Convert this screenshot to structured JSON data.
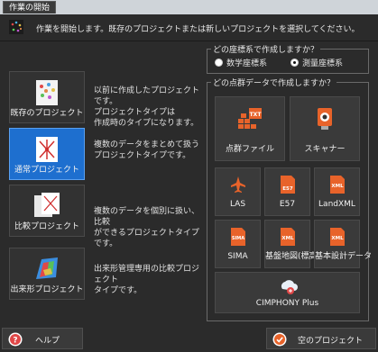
{
  "window": {
    "title": "作業の開始"
  },
  "hint": {
    "text": "作業を開始します。既存のプロジェクトまたは新しいプロジェクトを選択してください。"
  },
  "projects": [
    {
      "label": "既存のプロジェクト",
      "desc": "以前に作成したプロジェクトです。\nプロジェクトタイプは\n作成時のタイプになります。"
    },
    {
      "label": "通常プロジェクト",
      "desc": "複数のデータをまとめて扱う\nプロジェクトタイプです。"
    },
    {
      "label": "比較プロジェクト",
      "desc": "複数のデータを個別に扱い、比較\nができるプロジェクトタイプです。"
    },
    {
      "label": "出来形プロジェクト",
      "desc": "出来形管理専用の比較プロジェクト\nタイプです。"
    }
  ],
  "coord_group": {
    "title": "どの座標系で作成しますか？",
    "options": [
      "数学座標系",
      "測量座標系"
    ],
    "selected_index": 1
  },
  "pointcloud_group": {
    "title": "どの点群データで作成しますか？",
    "big": [
      {
        "label": "点群ファイル",
        "icon": "TXT"
      },
      {
        "label": "スキャナー",
        "icon": ""
      }
    ],
    "small": [
      {
        "label": "LAS",
        "icon": ""
      },
      {
        "label": "E57",
        "icon": "E57"
      },
      {
        "label": "LandXML",
        "icon": "XML"
      },
      {
        "label": "SIMA",
        "icon": "SIMA"
      },
      {
        "label": "基盤地図(標高)",
        "icon": "XML"
      },
      {
        "label": "基本設計データ",
        "icon": "XML"
      }
    ],
    "cimphony": {
      "label": "CIMPHONY Plus"
    }
  },
  "footer": {
    "help_label": "ヘルプ",
    "empty_label": "空のプロジェクト"
  },
  "colors": {
    "selected": "#1e6fcf",
    "accent": "#e8632a",
    "bg": "#2b2b2b"
  }
}
